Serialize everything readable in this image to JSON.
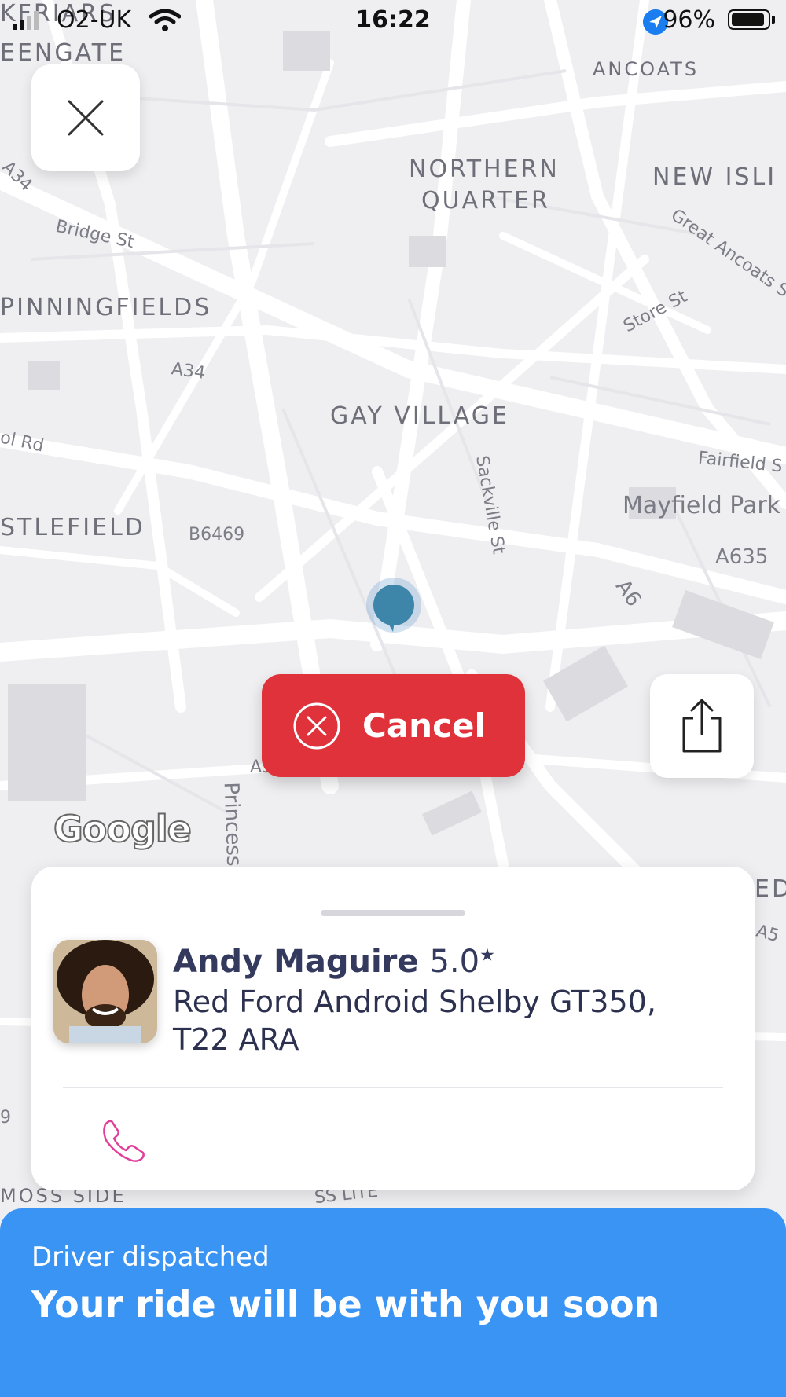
{
  "status_bar": {
    "carrier": "O2-UK",
    "time": "16:22",
    "battery": "96%"
  },
  "map": {
    "areas": [
      "NORTHERN",
      "QUARTER",
      "ANCOATS",
      "NEW ISLI",
      "PINNINGFIELDS",
      "GAY VILLAGE",
      "STLEFIELD",
      "EENGATE",
      "KFRIARS",
      "MOSS SIDE"
    ],
    "streets": [
      "Bridge St",
      "A34",
      "ol Rd",
      "B6469",
      "Sackville St",
      "Store St",
      "Great Ancoats S",
      "Fairfield S",
      "A635",
      "A6",
      "Princess",
      "A34",
      "A5",
      "EDL",
      "9",
      "SS LITE"
    ],
    "park": "Mayfield Park",
    "attribution": "Google"
  },
  "actions": {
    "cancel_label": "Cancel"
  },
  "driver": {
    "name": "Andy Maguire",
    "rating": "5.0",
    "rating_star": "★",
    "vehicle": "Red Ford Android Shelby GT350, T22 ARA"
  },
  "banner": {
    "subtitle": "Driver dispatched",
    "title": "Your ride will be with you soon"
  },
  "colors": {
    "cancel": "#e0323b",
    "banner": "#3a94f4",
    "phone_icon": "#e0409a",
    "pin": "#3d86a9"
  }
}
